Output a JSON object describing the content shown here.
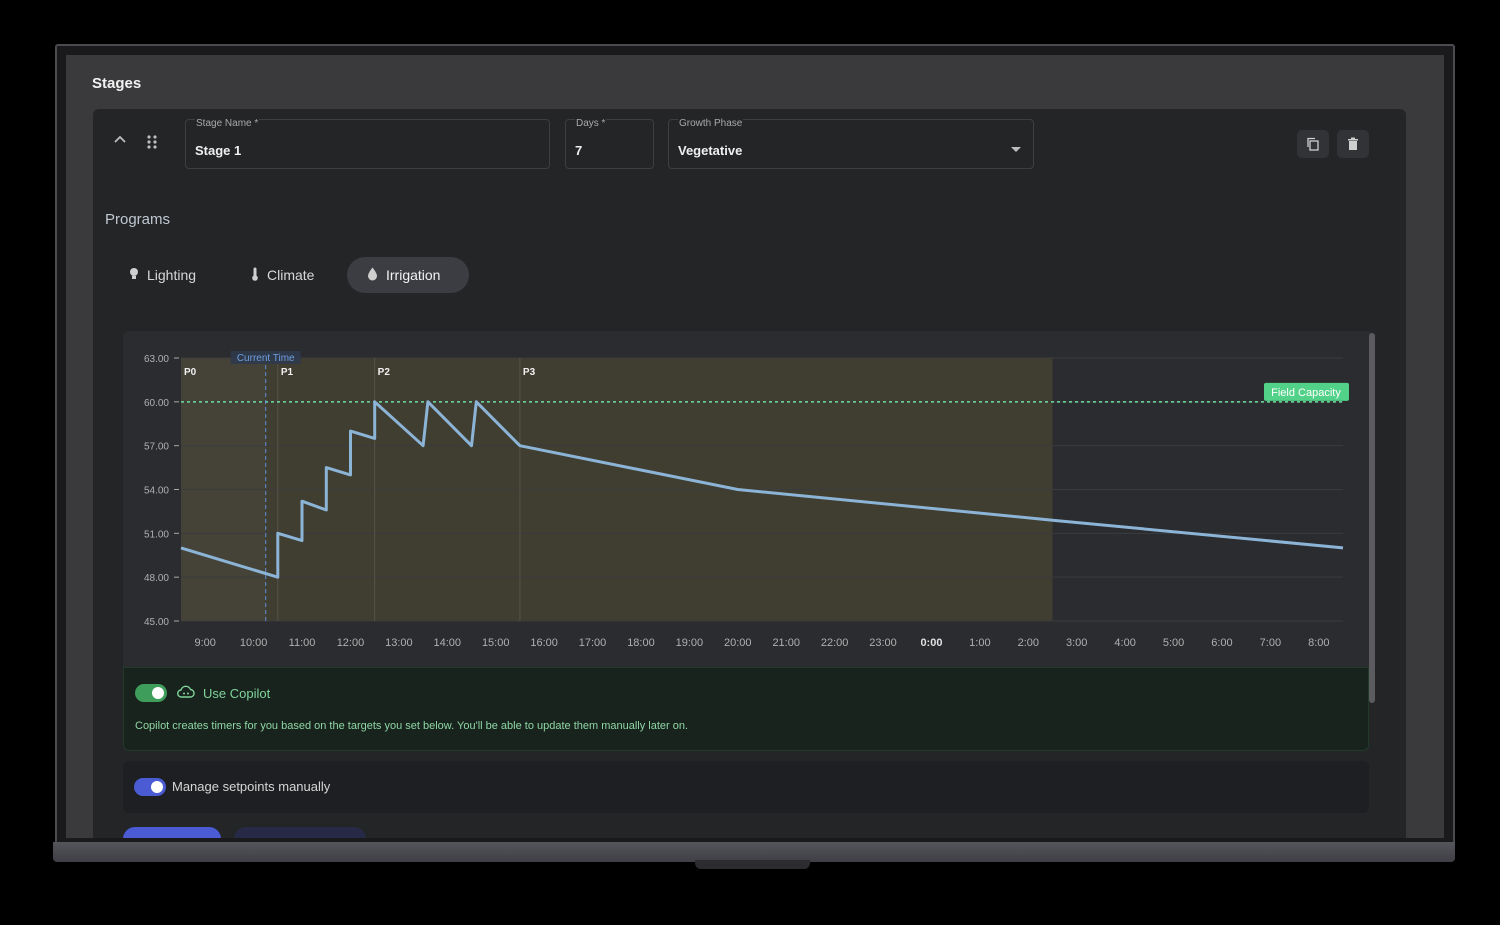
{
  "page": {
    "title": "Stages"
  },
  "stage": {
    "name_label": "Stage Name *",
    "name_value": "Stage 1",
    "days_label": "Days *",
    "days_value": "7",
    "phase_label": "Growth Phase",
    "phase_value": "Vegetative"
  },
  "programs": {
    "title": "Programs",
    "tabs": [
      {
        "label": "Lighting",
        "icon": "lightbulb-icon",
        "active": false
      },
      {
        "label": "Climate",
        "icon": "thermometer-icon",
        "active": false
      },
      {
        "label": "Irrigation",
        "icon": "water-drop-icon",
        "active": true
      }
    ]
  },
  "chart_data": {
    "type": "line",
    "y_ticks": [
      "63.00",
      "60.00",
      "57.00",
      "54.00",
      "51.00",
      "48.00",
      "45.00"
    ],
    "ylim": [
      45,
      63
    ],
    "x_ticks": [
      "9:00",
      "10:00",
      "11:00",
      "12:00",
      "13:00",
      "14:00",
      "15:00",
      "16:00",
      "17:00",
      "18:00",
      "19:00",
      "20:00",
      "21:00",
      "22:00",
      "23:00",
      "0:00",
      "1:00",
      "2:00",
      "3:00",
      "4:00",
      "5:00",
      "6:00",
      "7:00",
      "8:00"
    ],
    "x_range_hours": [
      8.5,
      32.5
    ],
    "current_time_label": "Current Time",
    "current_time_hour": 10.25,
    "phase_labels": [
      {
        "label": "P0",
        "hour": 8.5
      },
      {
        "label": "P1",
        "hour": 10.5
      },
      {
        "label": "P2",
        "hour": 12.5
      },
      {
        "label": "P3",
        "hour": 15.5
      }
    ],
    "shaded_until_hour": 26.5,
    "field_capacity_label": "Field Capacity",
    "field_capacity_value": 60,
    "series": [
      {
        "x": [
          8.5,
          10.5,
          10.5,
          11.0,
          11.0,
          11.5,
          11.5,
          12.0,
          12.0,
          12.5,
          12.5,
          13.5,
          13.6,
          14.5,
          14.6,
          15.5,
          20.0,
          26.5,
          32.5
        ],
        "y": [
          50.0,
          48.0,
          51.0,
          50.5,
          53.2,
          52.6,
          55.5,
          55.0,
          58.0,
          57.5,
          60.0,
          57.0,
          60.0,
          57.0,
          60.0,
          57.0,
          54.0,
          51.9,
          50.0
        ]
      }
    ],
    "colors": {
      "line": "#8cb4d6",
      "field_capacity": "#6fe0a0",
      "current_time": "#5f8fd1",
      "shade": "#403d31"
    }
  },
  "copilot": {
    "label": "Use Copilot",
    "icon": "cloud-copilot-icon",
    "description": "Copilot creates timers for you based on the targets you set below. You'll be able to update them manually later on.",
    "enabled": true
  },
  "manual": {
    "label": "Manage setpoints manually",
    "enabled": true
  }
}
